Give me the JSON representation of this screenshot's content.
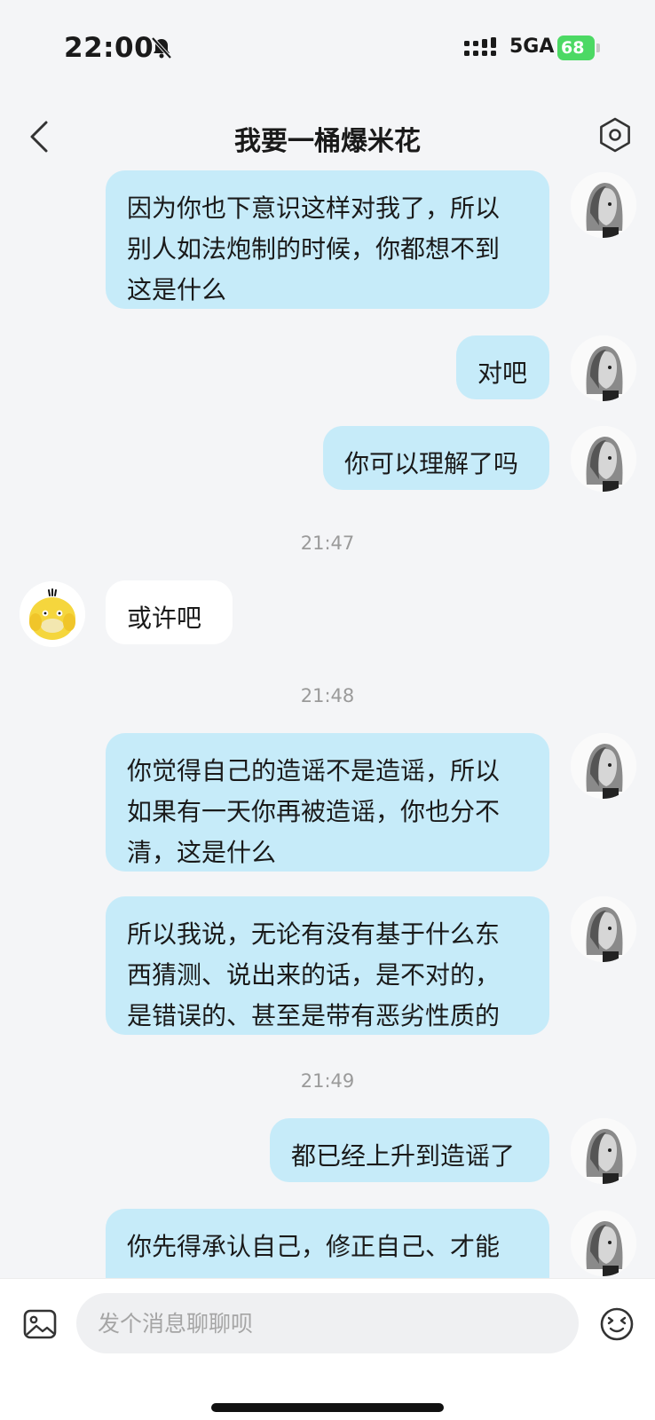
{
  "status_bar": {
    "time": "22:00",
    "network": "5GA",
    "battery": "68"
  },
  "header": {
    "title": "我要一桶爆米花"
  },
  "messages": [
    {
      "from": "me",
      "lines": [
        "因为你也下意识这样对我了，所以",
        "别人如法炮制的时候，你都想不到",
        "这是什么"
      ]
    },
    {
      "from": "me",
      "lines": [
        "对吧"
      ]
    },
    {
      "from": "me",
      "lines": [
        "你可以理解了吗"
      ]
    },
    {
      "time": "21:47"
    },
    {
      "from": "them",
      "lines": [
        "或许吧"
      ]
    },
    {
      "time": "21:48"
    },
    {
      "from": "me",
      "lines": [
        "你觉得自己的造谣不是造谣，所以",
        "如果有一天你再被造谣，你也分不",
        "清，这是什么"
      ]
    },
    {
      "from": "me",
      "lines": [
        "所以我说，无论有没有基于什么东",
        "西猜测、说出来的话，是不对的，",
        "是错误的、甚至是带有恶劣性质的"
      ]
    },
    {
      "time": "21:49"
    },
    {
      "from": "me",
      "lines": [
        "都已经上升到造谣了"
      ]
    },
    {
      "from": "me",
      "lines": [
        "你先得承认自己，修正自己、才能"
      ]
    }
  ],
  "input": {
    "placeholder": "发个消息聊聊呗"
  },
  "colors": {
    "outgoing_bubble": "#c6ebf9",
    "incoming_bubble": "#ffffff",
    "background": "#f4f5f7",
    "battery": "#4cd964"
  }
}
